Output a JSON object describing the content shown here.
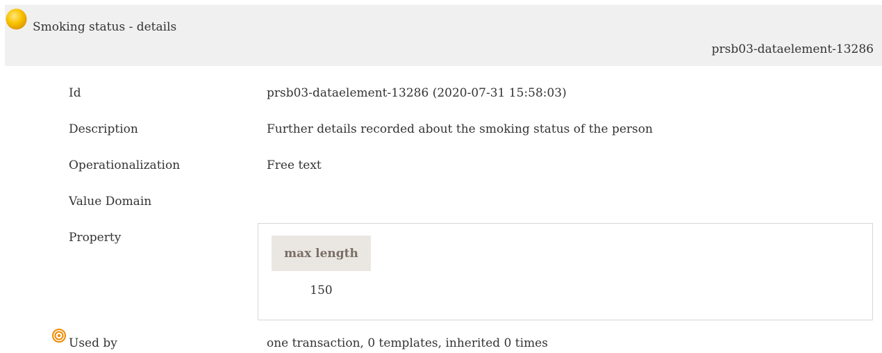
{
  "header": {
    "title": "Smoking status - details",
    "element_id": "prsb03-dataelement-13286",
    "status_icon": "yellow-circle-icon",
    "status_color": "#f5b800"
  },
  "rows": {
    "id": {
      "label": "Id",
      "value": "prsb03-dataelement-13286 (2020-07-31 15:58:03)"
    },
    "description": {
      "label": "Description",
      "value": "Further details recorded about the smoking status of the person"
    },
    "operationalization": {
      "label": "Operationalization",
      "value": "Free text"
    },
    "value_domain": {
      "label": "Value Domain",
      "value": ""
    },
    "property": {
      "label": "Property"
    },
    "used_by": {
      "label": "Used by",
      "value": "one transaction, 0 templates, inherited 0 times",
      "icon": "target-icon",
      "icon_color": "#f08a00"
    }
  },
  "property_table": {
    "header": "max length",
    "value": "150"
  }
}
